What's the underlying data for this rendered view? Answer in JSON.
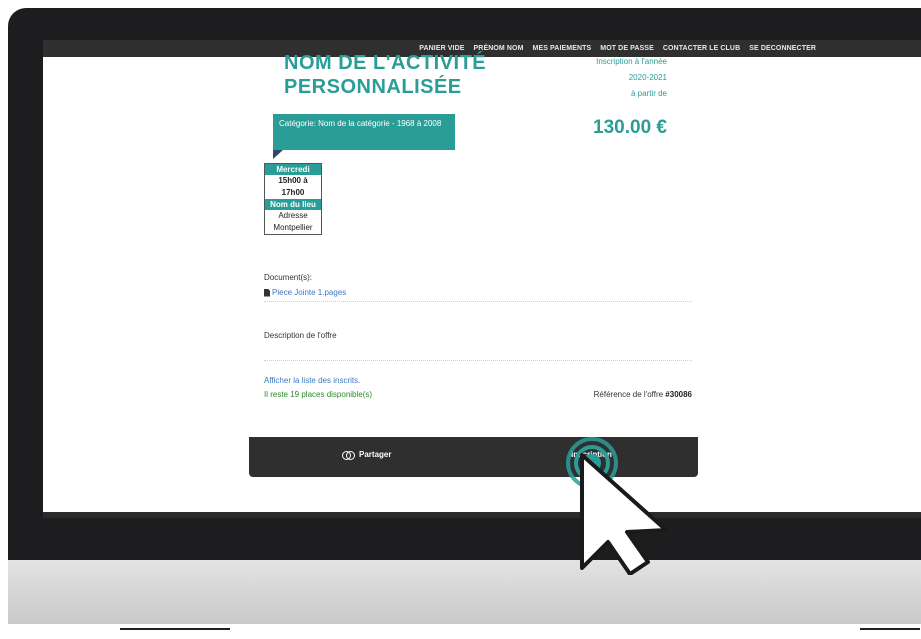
{
  "nav": {
    "items": [
      "PANIER VIDE",
      "PRÉNOM NOM",
      "MES PAIEMENTS",
      "MOT DE PASSE",
      "CONTACTER LE CLUB",
      "SE DECONNECTER"
    ]
  },
  "activity": {
    "title_line1": "NOM DE L'ACTIVITÉ",
    "title_line2": "PERSONNALISÉE",
    "enroll_label": "Inscription à l'année",
    "season": "2020-2021",
    "from_label": "à partir de",
    "price": "130.00 €",
    "category": "Catégorie: Nom de la catégorie - 1968 à 2008"
  },
  "schedule": {
    "day": "Mercredi",
    "time_line1": "15h00 à",
    "time_line2": "17h00",
    "place_header": "Nom du lieu",
    "address": "Adresse",
    "city": "Montpellier"
  },
  "documents": {
    "label": "Document(s):",
    "file": "Piece Jointe 1.pages"
  },
  "offer": {
    "description": "Description de l'offre",
    "list_link": "Afficher la liste des inscrits.",
    "places": "Il reste 19 places disponible(s)",
    "reference_label": "Référence de l'offre",
    "reference_number": "#30086"
  },
  "actions": {
    "share_label": "Partager",
    "inscription_label": "Inscription"
  },
  "colors": {
    "accent": "#2a9d96",
    "link": "#3a79c2",
    "success": "#2a8a2a",
    "bar": "#2f2f2f"
  },
  "icons": [
    "file-icon",
    "share-icon",
    "cursor-arrow-icon",
    "click-ripple-icon"
  ]
}
